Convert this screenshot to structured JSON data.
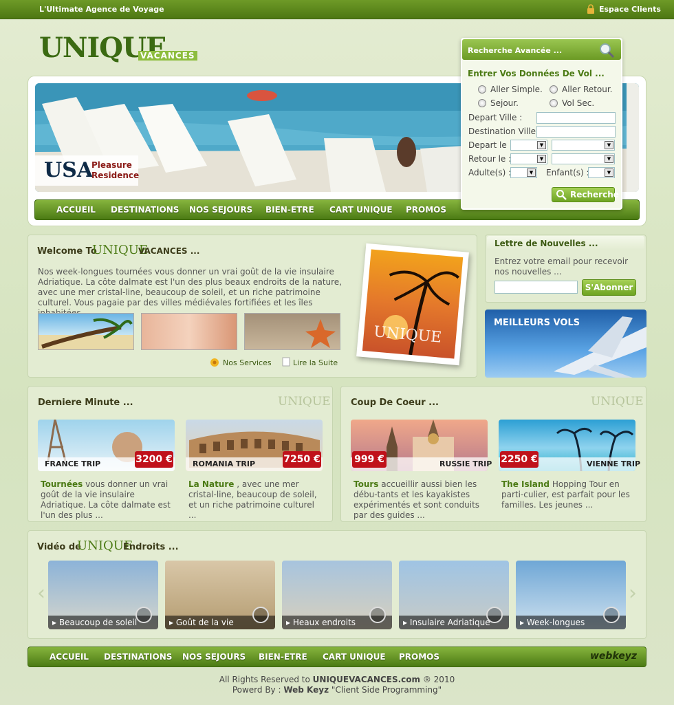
{
  "topbar": {
    "tagline": "L'Ultimate Agence de Voyage",
    "espace_clients": "Espace Clients"
  },
  "logo": {
    "main": "UNIQUE",
    "sub": "VACANCES"
  },
  "hero": {
    "country": "USA",
    "line1": "Pleasure",
    "line2": "Residence"
  },
  "nav": [
    "ACCUEIL",
    "DESTINATIONS",
    "NOS SEJOURS",
    "BIEN-ETRE",
    "CART UNIQUE",
    "PROMOS"
  ],
  "search": {
    "header": "Recherche Avancée ...",
    "title": "Entrer Vos Données De Vol ...",
    "radios": [
      "Aller Simple.",
      "Aller Retour.",
      "Sejour.",
      "Vol Sec."
    ],
    "depart_ville": "Depart Ville  :",
    "destination_ville": "Destination Ville :",
    "depart_le": "Depart le :",
    "retour_le": "Retour le :",
    "adultes": "Adulte(s) :",
    "enfants": "Enfant(s) :",
    "button": "Recherche"
  },
  "welcome": {
    "title_pre": "Welcome To",
    "title_brand": "UNIQUE",
    "title_post": "VACANCES ...",
    "text": "Nos week-longues tournées vous donner un vrai goût de la vie insulaire Adriatique. La côte dalmate est l'un des plus beaux endroits de la nature, avec une mer cristal-line, beaucoup de soleil, et un riche patrimoine culturel. Vous pagaie par des villes médiévales fortifiées et les îles inhabitées ...",
    "services_link": "Nos Services",
    "suite_link": "Lire la Suite",
    "photo_caption": "UNIQUE"
  },
  "newsletter": {
    "title": "Lettre de Nouvelles ...",
    "text": "Entrez votre email pour recevoir nos nouvelles ...",
    "button": "S'Abonner"
  },
  "meilleurs": {
    "label": "MEILLEURS VOLS"
  },
  "derniere": {
    "title": "Derniere Minute ...",
    "brand": "UNIQUE",
    "trips": [
      {
        "label": "FRANCE TRIP",
        "price": "3200 €",
        "bold": "Tournées",
        "text": " vous donner un vrai goût de la vie insulaire Adriatique. La côte dalmate est l'un des plus ..."
      },
      {
        "label": "ROMANIA TRIP",
        "price": "7250 €",
        "bold": "La Nature",
        "text": " , avec une mer cristal-line, beaucoup de soleil, et un riche patrimoine culturel ..."
      }
    ]
  },
  "coeur": {
    "title": "Coup De Coeur ...",
    "brand": "UNIQUE",
    "trips": [
      {
        "label": "RUSSIE TRIP",
        "price": "999 €",
        "bold": "Tours",
        "text": " accueillir aussi bien les débu-tants et les kayakistes expérimentés et sont conduits par des guides ..."
      },
      {
        "label": "VIENNE TRIP",
        "price": "2250 €",
        "bold": "The Island",
        "text": " Hopping Tour en parti-culier, est parfait pour les familles. Les jeunes ..."
      }
    ]
  },
  "video": {
    "title_pre": "Vidéo de",
    "title_brand": "UNIQUE",
    "title_post": "Endroits ...",
    "items": [
      "Beaucoup de soleil",
      "Goût de la vie",
      "Heaux endroits",
      "Insulaire Adriatique",
      "Week-longues"
    ]
  },
  "footer_nav": [
    "ACCUEIL",
    "DESTINATIONS",
    "NOS SEJOURS",
    "BIEN-ETRE",
    "CART UNIQUE",
    "PROMOS"
  ],
  "footer_logo": "webkeyz",
  "footer": {
    "rights_pre": "All Rights Reserved to",
    "rights_site": "UNIQUEVACANCES.com",
    "rights_post": "® 2010",
    "powered_pre": "Powerd By :",
    "powered_name": "Web Keyz",
    "powered_post": "\"Client Side Programming\""
  }
}
